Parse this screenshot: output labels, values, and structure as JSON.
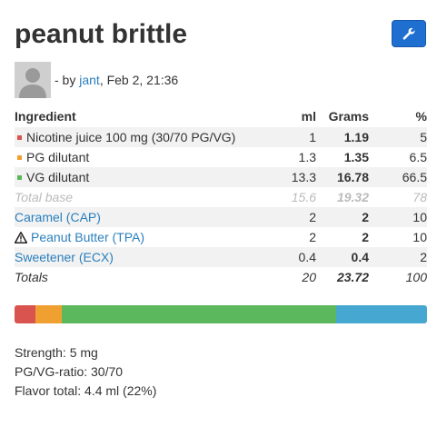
{
  "recipe": {
    "title": "peanut brittle",
    "by_prefix": "- by",
    "author": "jant",
    "date": "Feb 2, 21:36"
  },
  "toolbar": {
    "tools_icon": "wrench-icon"
  },
  "table": {
    "headers": {
      "ingredient": "Ingredient",
      "ml": "ml",
      "grams": "Grams",
      "percent": "%"
    },
    "rows": [
      {
        "name": "Nicotine juice 100 mg (30/70 PG/VG)",
        "ml": "1",
        "grams": "1.19",
        "percent": "5",
        "color": "#d9534f"
      },
      {
        "name": "PG dilutant",
        "ml": "1.3",
        "grams": "1.35",
        "percent": "6.5",
        "color": "#f0a030"
      },
      {
        "name": "VG dilutant",
        "ml": "13.3",
        "grams": "16.78",
        "percent": "66.5",
        "color": "#5cb85c"
      }
    ],
    "total_base": {
      "name": "Total base",
      "ml": "15.6",
      "grams": "19.32",
      "percent": "78"
    },
    "flavors": [
      {
        "name": "Caramel (CAP)",
        "ml": "2",
        "grams": "2",
        "percent": "10",
        "warning": false
      },
      {
        "name": "Peanut Butter (TPA)",
        "ml": "2",
        "grams": "2",
        "percent": "10",
        "warning": true
      },
      {
        "name": "Sweetener (ECX)",
        "ml": "0.4",
        "grams": "0.4",
        "percent": "2",
        "warning": false
      }
    ],
    "totals": {
      "name": "Totals",
      "ml": "20",
      "grams": "23.72",
      "percent": "100"
    }
  },
  "composition_bar": [
    {
      "part": "nicotine",
      "percent": 5,
      "color": "#d9534f"
    },
    {
      "part": "pg",
      "percent": 6.5,
      "color": "#f0a030"
    },
    {
      "part": "vg",
      "percent": 66.5,
      "color": "#5cb85c"
    },
    {
      "part": "flavor",
      "percent": 22,
      "color": "#46a8d0"
    }
  ],
  "stats": {
    "strength": "Strength: 5 mg",
    "pgvg": "PG/VG-ratio: 30/70",
    "flavor_total": "Flavor total: 4.4 ml (22%)"
  }
}
